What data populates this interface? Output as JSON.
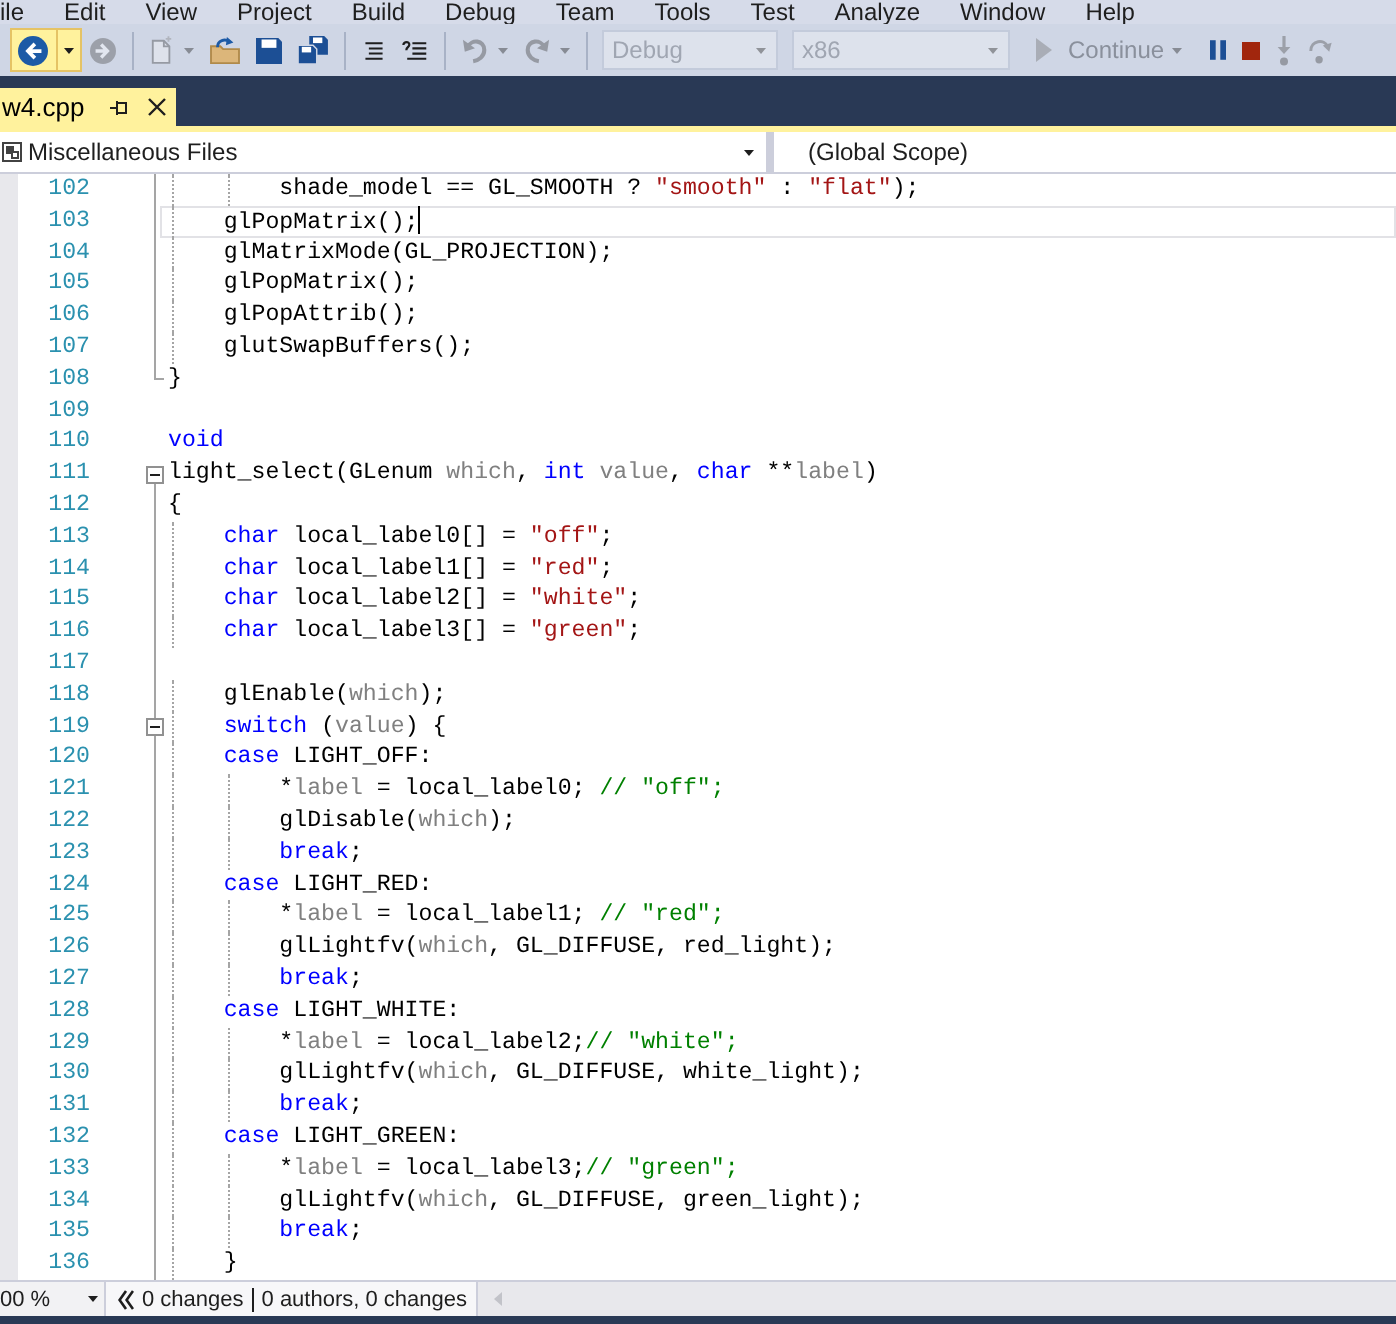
{
  "menu": [
    "ile",
    "Edit",
    "View",
    "Project",
    "Build",
    "Debug",
    "Team",
    "Tools",
    "Test",
    "Analyze",
    "Window",
    "Help"
  ],
  "toolbar": {
    "back": {
      "hovered": true
    },
    "forward": {
      "disabled": true
    },
    "new_project": {
      "disabled": true
    },
    "open_file": {
      "disabled": false
    },
    "save": {
      "disabled": false
    },
    "save_all": {
      "disabled": false
    },
    "comment": {
      "disabled": false
    },
    "uncomment": {
      "disabled": false
    },
    "undo": {
      "disabled": true
    },
    "redo": {
      "disabled": true
    },
    "configuration": {
      "value": "Debug",
      "disabled": true
    },
    "platform": {
      "value": "x86",
      "disabled": true
    },
    "continue": {
      "label": "Continue",
      "disabled": true
    },
    "pause": {
      "disabled": false
    },
    "stop": {
      "disabled": false
    },
    "step_into": {
      "disabled": true
    },
    "step_over": {
      "disabled": true
    }
  },
  "tabs": [
    {
      "label": "w4.cpp",
      "selected": true
    }
  ],
  "navigation_bar": {
    "project": "Miscellaneous Files",
    "scope": "(Global Scope)"
  },
  "editor": {
    "lines": [
      {
        "number": "102",
        "kind": "body",
        "current": false,
        "tokens": [
          {
            "kind": "plain",
            "text": "        shade_model == GL_SMOOTH ? "
          },
          {
            "kind": "string",
            "text": "\"smooth\""
          },
          {
            "kind": "plain",
            "text": " : "
          },
          {
            "kind": "string",
            "text": "\"flat\""
          },
          {
            "kind": "plain",
            "text": ");"
          }
        ]
      },
      {
        "number": "103",
        "kind": "body",
        "current": true,
        "tokens": [
          {
            "kind": "plain",
            "text": "    glPopMatrix();"
          }
        ]
      },
      {
        "number": "104",
        "kind": "body",
        "current": false,
        "tokens": [
          {
            "kind": "plain",
            "text": "    glMatrixMode(GL_PROJECTION);"
          }
        ]
      },
      {
        "number": "105",
        "kind": "body",
        "current": false,
        "tokens": [
          {
            "kind": "plain",
            "text": "    glPopMatrix();"
          }
        ]
      },
      {
        "number": "106",
        "kind": "body",
        "current": false,
        "tokens": [
          {
            "kind": "plain",
            "text": "    glPopAttrib();"
          }
        ]
      },
      {
        "number": "107",
        "kind": "body",
        "current": false,
        "tokens": [
          {
            "kind": "plain",
            "text": "    glutSwapBuffers();"
          }
        ]
      },
      {
        "number": "108",
        "kind": "footer",
        "current": false,
        "tokens": [
          {
            "kind": "plain",
            "text": "}"
          }
        ]
      },
      {
        "number": "109",
        "kind": "plain",
        "current": false
      },
      {
        "number": "110",
        "kind": "plain",
        "current": false,
        "tokens": [
          {
            "kind": "keyword",
            "text": "void"
          }
        ]
      },
      {
        "number": "111",
        "kind": "header",
        "expanded": true,
        "current": false,
        "tokens": [
          {
            "kind": "plain",
            "text": "light_select(GLenum "
          },
          {
            "kind": "parameter",
            "text": "which"
          },
          {
            "kind": "plain",
            "text": ", "
          },
          {
            "kind": "keyword",
            "text": "int"
          },
          {
            "kind": "parameter",
            "text": " value"
          },
          {
            "kind": "plain",
            "text": ", "
          },
          {
            "kind": "keyword",
            "text": "char"
          },
          {
            "kind": "plain",
            "text": " **"
          },
          {
            "kind": "parameter",
            "text": "label"
          },
          {
            "kind": "plain",
            "text": ")"
          }
        ]
      },
      {
        "number": "112",
        "kind": "body",
        "current": false,
        "tokens": [
          {
            "kind": "plain",
            "text": "{"
          }
        ]
      },
      {
        "number": "113",
        "kind": "body",
        "current": false,
        "tokens": [
          {
            "kind": "keyword",
            "text": "    char"
          },
          {
            "kind": "plain",
            "text": " local_label0[] = "
          },
          {
            "kind": "string",
            "text": "\"off\""
          },
          {
            "kind": "plain",
            "text": ";"
          }
        ]
      },
      {
        "number": "114",
        "kind": "body",
        "current": false,
        "tokens": [
          {
            "kind": "keyword",
            "text": "    char"
          },
          {
            "kind": "plain",
            "text": " local_label1[] = "
          },
          {
            "kind": "string",
            "text": "\"red\""
          },
          {
            "kind": "plain",
            "text": ";"
          }
        ]
      },
      {
        "number": "115",
        "kind": "body",
        "current": false,
        "tokens": [
          {
            "kind": "keyword",
            "text": "    char"
          },
          {
            "kind": "plain",
            "text": " local_label2[] = "
          },
          {
            "kind": "string",
            "text": "\"white\""
          },
          {
            "kind": "plain",
            "text": ";"
          }
        ]
      },
      {
        "number": "116",
        "kind": "body",
        "current": false,
        "tokens": [
          {
            "kind": "keyword",
            "text": "    char"
          },
          {
            "kind": "plain",
            "text": " local_label3[] = "
          },
          {
            "kind": "string",
            "text": "\"green\""
          },
          {
            "kind": "plain",
            "text": ";"
          }
        ]
      },
      {
        "number": "117",
        "kind": "body",
        "current": false
      },
      {
        "number": "118",
        "kind": "body",
        "current": false,
        "tokens": [
          {
            "kind": "plain",
            "text": "    glEnable("
          },
          {
            "kind": "parameter",
            "text": "which"
          },
          {
            "kind": "plain",
            "text": ");"
          }
        ]
      },
      {
        "number": "119",
        "kind": "header",
        "expanded": true,
        "current": false,
        "tokens": [
          {
            "kind": "keyword",
            "text": "    switch"
          },
          {
            "kind": "plain",
            "text": " ("
          },
          {
            "kind": "parameter",
            "text": "value"
          },
          {
            "kind": "plain",
            "text": ") {"
          }
        ]
      },
      {
        "number": "120",
        "kind": "body",
        "current": false,
        "tokens": [
          {
            "kind": "keyword",
            "text": "    case"
          },
          {
            "kind": "plain",
            "text": " LIGHT_OFF:"
          }
        ]
      },
      {
        "number": "121",
        "kind": "body",
        "current": false,
        "tokens": [
          {
            "kind": "plain",
            "text": "        *"
          },
          {
            "kind": "parameter",
            "text": "label"
          },
          {
            "kind": "plain",
            "text": " = local_label0; "
          },
          {
            "kind": "comment",
            "text": "// \"off\";"
          }
        ]
      },
      {
        "number": "122",
        "kind": "body",
        "current": false,
        "tokens": [
          {
            "kind": "plain",
            "text": "        glDisable("
          },
          {
            "kind": "parameter",
            "text": "which"
          },
          {
            "kind": "plain",
            "text": ");"
          }
        ]
      },
      {
        "number": "123",
        "kind": "body",
        "current": false,
        "tokens": [
          {
            "kind": "keyword",
            "text": "        break"
          },
          {
            "kind": "plain",
            "text": ";"
          }
        ]
      },
      {
        "number": "124",
        "kind": "body",
        "current": false,
        "tokens": [
          {
            "kind": "keyword",
            "text": "    case"
          },
          {
            "kind": "plain",
            "text": " LIGHT_RED:"
          }
        ]
      },
      {
        "number": "125",
        "kind": "body",
        "current": false,
        "tokens": [
          {
            "kind": "plain",
            "text": "        *"
          },
          {
            "kind": "parameter",
            "text": "label"
          },
          {
            "kind": "plain",
            "text": " = local_label1; "
          },
          {
            "kind": "comment",
            "text": "// \"red\";"
          }
        ]
      },
      {
        "number": "126",
        "kind": "body",
        "current": false,
        "tokens": [
          {
            "kind": "plain",
            "text": "        glLightfv("
          },
          {
            "kind": "parameter",
            "text": "which"
          },
          {
            "kind": "plain",
            "text": ", GL_DIFFUSE, red_light);"
          }
        ]
      },
      {
        "number": "127",
        "kind": "body",
        "current": false,
        "tokens": [
          {
            "kind": "keyword",
            "text": "        break"
          },
          {
            "kind": "plain",
            "text": ";"
          }
        ]
      },
      {
        "number": "128",
        "kind": "body",
        "current": false,
        "tokens": [
          {
            "kind": "keyword",
            "text": "    case"
          },
          {
            "kind": "plain",
            "text": " LIGHT_WHITE:"
          }
        ]
      },
      {
        "number": "129",
        "kind": "body",
        "current": false,
        "tokens": [
          {
            "kind": "plain",
            "text": "        *"
          },
          {
            "kind": "parameter",
            "text": "label"
          },
          {
            "kind": "plain",
            "text": " = local_label2;"
          },
          {
            "kind": "comment",
            "text": "// \"white\";"
          }
        ]
      },
      {
        "number": "130",
        "kind": "body",
        "current": false,
        "tokens": [
          {
            "kind": "plain",
            "text": "        glLightfv("
          },
          {
            "kind": "parameter",
            "text": "which"
          },
          {
            "kind": "plain",
            "text": ", GL_DIFFUSE, white_light);"
          }
        ]
      },
      {
        "number": "131",
        "kind": "body",
        "current": false,
        "tokens": [
          {
            "kind": "keyword",
            "text": "        break"
          },
          {
            "kind": "plain",
            "text": ";"
          }
        ]
      },
      {
        "number": "132",
        "kind": "body",
        "current": false,
        "tokens": [
          {
            "kind": "keyword",
            "text": "    case"
          },
          {
            "kind": "plain",
            "text": " LIGHT_GREEN:"
          }
        ]
      },
      {
        "number": "133",
        "kind": "body",
        "current": false,
        "tokens": [
          {
            "kind": "plain",
            "text": "        *"
          },
          {
            "kind": "parameter",
            "text": "label"
          },
          {
            "kind": "plain",
            "text": " = local_label3;"
          },
          {
            "kind": "comment",
            "text": "// \"green\";"
          }
        ]
      },
      {
        "number": "134",
        "kind": "body",
        "current": false,
        "tokens": [
          {
            "kind": "plain",
            "text": "        glLightfv("
          },
          {
            "kind": "parameter",
            "text": "which"
          },
          {
            "kind": "plain",
            "text": ", GL_DIFFUSE, green_light);"
          }
        ]
      },
      {
        "number": "135",
        "kind": "body",
        "current": false,
        "tokens": [
          {
            "kind": "keyword",
            "text": "        break"
          },
          {
            "kind": "plain",
            "text": ";"
          }
        ]
      },
      {
        "number": "136",
        "kind": "body",
        "current": false,
        "tokens": [
          {
            "kind": "plain",
            "text": "    }"
          }
        ]
      }
    ]
  },
  "status_bar": {
    "zoom": "00 %",
    "changes": "0 changes",
    "authors": "0 authors, 0 changes"
  }
}
